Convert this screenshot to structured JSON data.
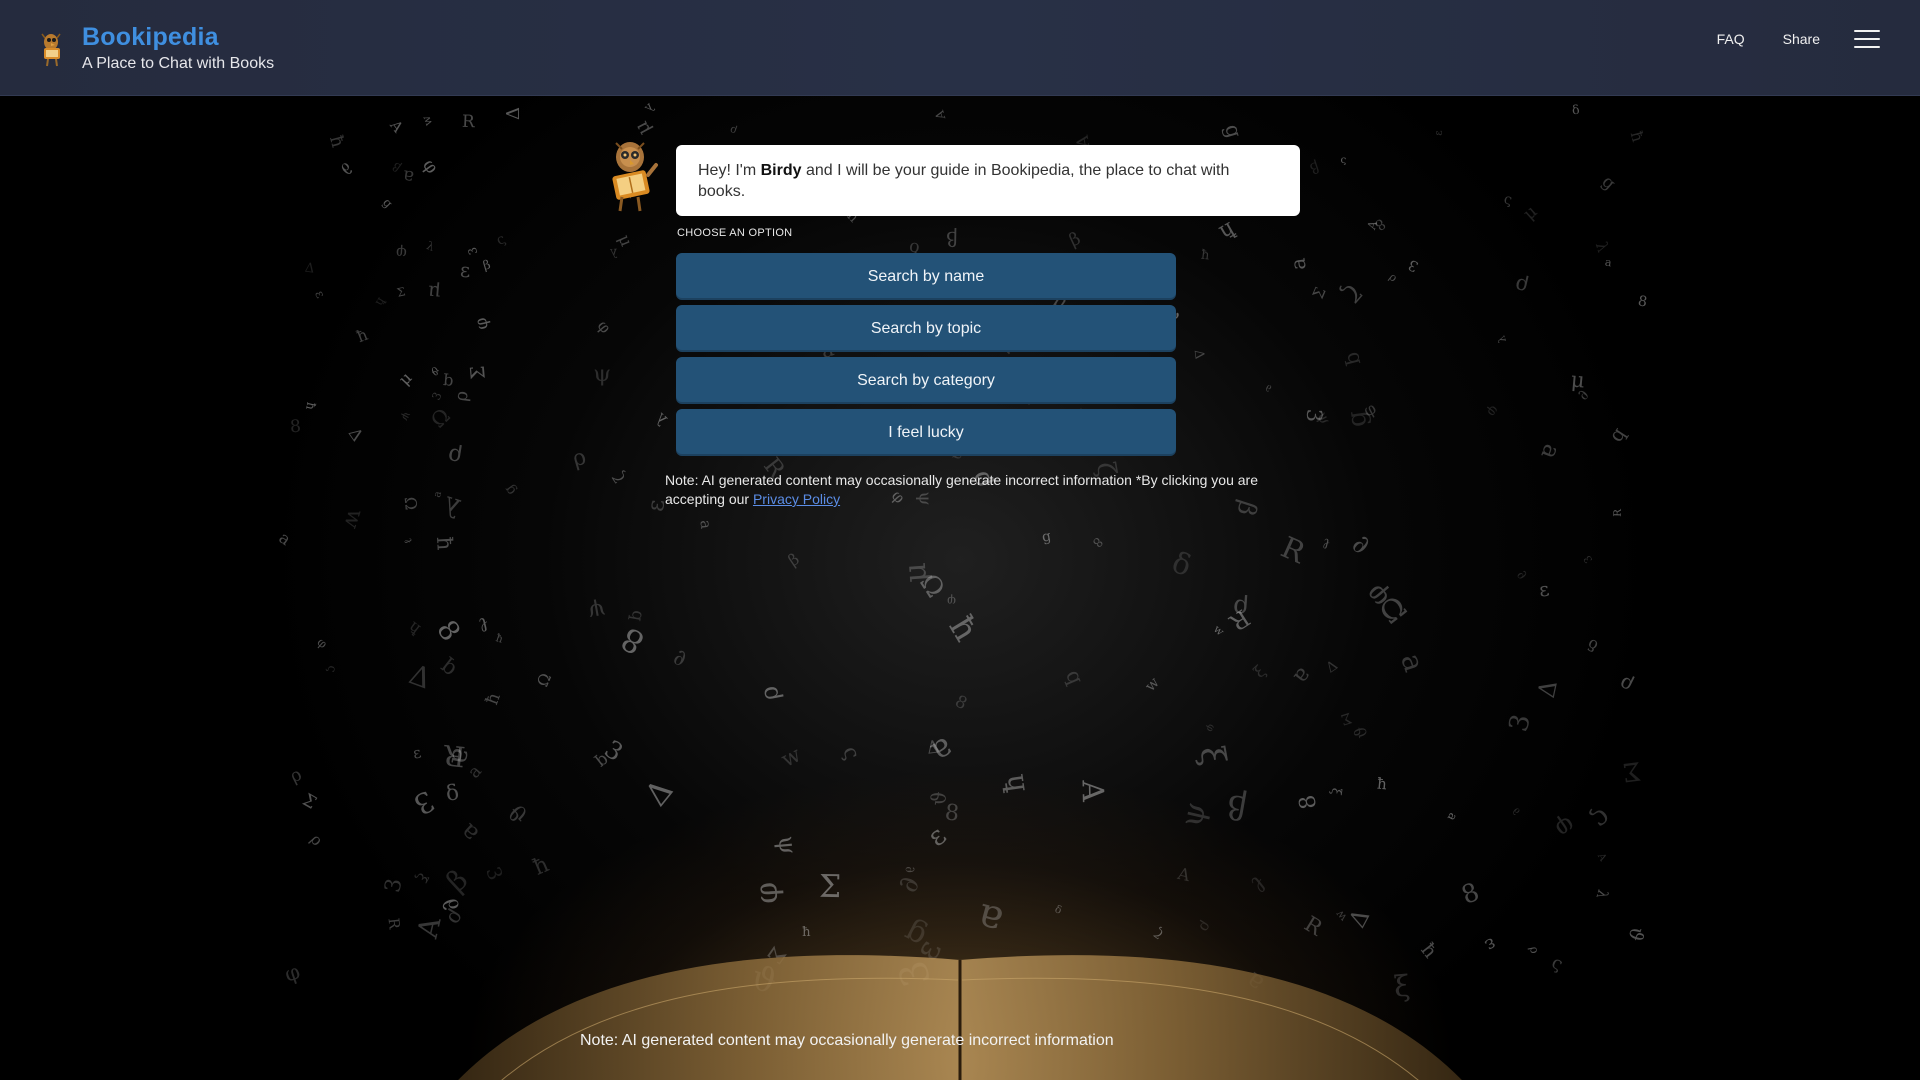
{
  "header": {
    "title": "Bookipedia",
    "subtitle": "A Place to Chat with Books",
    "logo_icon": "bird-reading-icon",
    "nav": {
      "faq_label": "FAQ",
      "share_label": "Share",
      "menu_icon": "hamburger-menu-icon"
    }
  },
  "chat": {
    "avatar_icon": "birdy-robot-avatar-icon",
    "greeting_prefix": "Hey! I'm ",
    "guide_name": "Birdy",
    "greeting_suffix": " and I will be your guide in Bookipedia, the place to chat with books.",
    "choose_label": "CHOOSE AN OPTION",
    "options": [
      {
        "label": "Search by name"
      },
      {
        "label": "Search by topic"
      },
      {
        "label": "Search by category"
      },
      {
        "label": "I feel lucky"
      }
    ]
  },
  "note": {
    "text": "Note: AI generated content may occasionally generate incorrect information *By clicking you are accepting our ",
    "link_label": "Privacy Policy"
  },
  "footer": {
    "note": "Note: AI generated content may occasionally generate incorrect information"
  },
  "colors": {
    "header_bg": "#283046",
    "brand_accent": "#3f8fe0",
    "option_button": "#235277",
    "link": "#5b8de6"
  }
}
